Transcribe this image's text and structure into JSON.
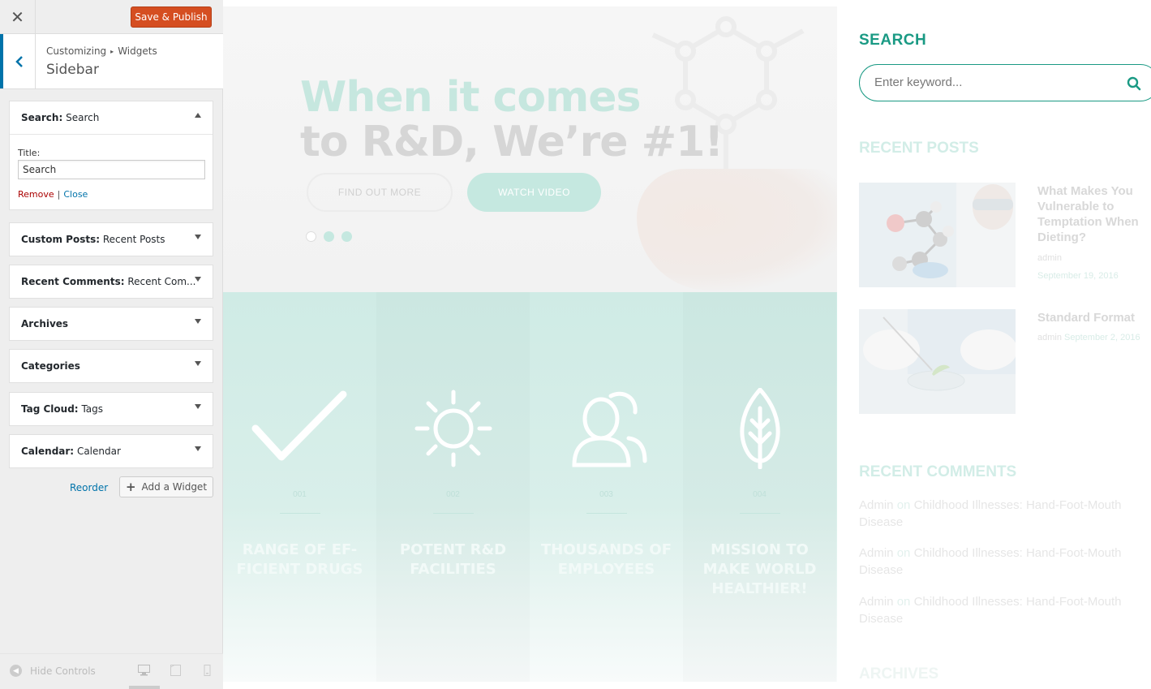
{
  "panel": {
    "close_glyph": "✕",
    "save_label": "Save & Publish",
    "back_glyph": "‹",
    "breadcrumb": {
      "parent": "Customizing",
      "separator": "▸",
      "child": "Widgets"
    },
    "section_title": "Sidebar",
    "expanded_widget": {
      "type": "Search:",
      "name": "Search",
      "title_label": "Title:",
      "title_value": "Search",
      "remove_label": "Remove",
      "link_sep": "|",
      "close_label": "Close"
    },
    "widgets": [
      {
        "type": "Custom Posts:",
        "name": "Recent Posts"
      },
      {
        "type": "Recent Comments:",
        "name": "Recent Com..."
      },
      {
        "type": "Archives",
        "name": ""
      },
      {
        "type": "Categories",
        "name": ""
      },
      {
        "type": "Tag Cloud:",
        "name": "Tags"
      },
      {
        "type": "Calendar:",
        "name": "Calendar"
      }
    ],
    "reorder_label": "Reorder",
    "add_widget_plus": "+",
    "add_widget_label": "Add a Widget",
    "hide_controls_label": "Hide Controls",
    "hide_controls_glyph": "◀"
  },
  "preview": {
    "hero": {
      "line1": "When it comes",
      "line2": "to R&D, We’re #1!",
      "find_out_label": "FIND OUT MORE",
      "watch_label": "WATCH VIDEO"
    },
    "features": [
      {
        "number": "001",
        "title": "RANGE OF EF- FICIENT DRUGS",
        "icon": "check-icon"
      },
      {
        "number": "002",
        "title": "POTENT R&D FACILITIES",
        "icon": "sun-icon"
      },
      {
        "number": "003",
        "title": "THOUSANDS OF EMPLOYEES",
        "icon": "people-icon"
      },
      {
        "number": "004",
        "title": "MISSION TO MAKE WORLD HEALTHIER!",
        "icon": "leaf-icon"
      }
    ],
    "sidebar": {
      "search_title": "SEARCH",
      "search_placeholder": "Enter keyword...",
      "recent_posts_title": "RECENT POSTS",
      "posts": [
        {
          "title": "What Makes You Vulnerable to Temptation When Dieting?",
          "author": "admin",
          "date": "September 19, 2016"
        },
        {
          "title": "Standard Format",
          "author": "admin",
          "date": "September 2, 2016"
        }
      ],
      "recent_comments_title": "RECENT COMMENTS",
      "comments": [
        {
          "author": "Admin",
          "on": "on",
          "post": "Childhood Illnesses: Hand-Foot-Mouth Disease"
        },
        {
          "author": "Admin",
          "on": "on",
          "post": "Childhood Illnesses: Hand-Foot-Mouth Disease"
        },
        {
          "author": "Admin",
          "on": "on",
          "post": "Childhood Illnesses: Hand-Foot-Mouth Disease"
        }
      ],
      "archives_title": "ARCHIVES"
    }
  },
  "colors": {
    "wp_blue": "#0073aa",
    "publish_red": "#d54e21",
    "accent_teal": "#1a9a84"
  }
}
